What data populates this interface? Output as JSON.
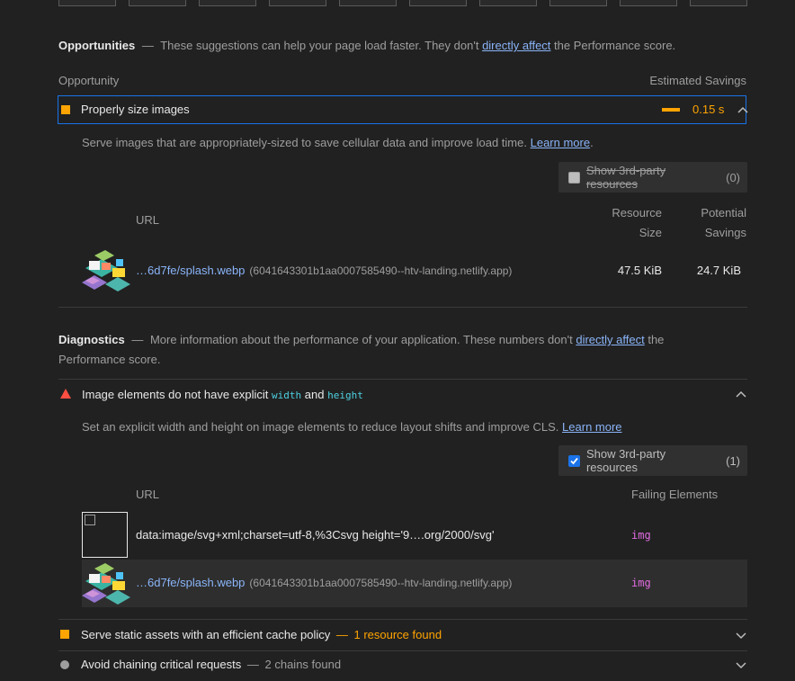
{
  "opportunities": {
    "title": "Opportunities",
    "dash": "—",
    "desc_prefix": "These suggestions can help your page load faster. They don't",
    "desc_link": "directly affect",
    "desc_suffix": "the Performance score.",
    "col_opportunity": "Opportunity",
    "col_savings": "Estimated Savings",
    "audit": {
      "title": "Properly size images",
      "savings": "0.15 s",
      "description": "Serve images that are appropriately-sized to save cellular data and improve load time.",
      "learn_more": "Learn more",
      "period": ".",
      "third_party_label": "Show 3rd-party resources",
      "third_party_count": "(0)",
      "headers": {
        "url": "URL",
        "resource_size_1": "Resource",
        "resource_size_2": "Size",
        "potential_1": "Potential",
        "potential_2": "Savings"
      },
      "rows": [
        {
          "url": "…6d7fe/splash.webp",
          "host": "(6041643301b1aa0007585490--htv-landing.netlify.app)",
          "size": "47.5 KiB",
          "savings": "24.7 KiB"
        }
      ]
    }
  },
  "diagnostics": {
    "title": "Diagnostics",
    "dash": "—",
    "desc_prefix": "More information about the performance of your application. These numbers don't",
    "desc_link": "directly affect",
    "desc_suffix_1": "the",
    "desc_suffix_2": "Performance score.",
    "audit": {
      "title_prefix": "Image elements do not have explicit",
      "code_width": "width",
      "and": "and",
      "code_height": "height",
      "description": "Set an explicit width and height on image elements to reduce layout shifts and improve CLS.",
      "learn_more": "Learn more",
      "third_party_label": "Show 3rd-party resources",
      "third_party_count": "(1)",
      "headers": {
        "url": "URL",
        "failing": "Failing Elements"
      },
      "rows": [
        {
          "url": "data:image/svg+xml;charset=utf-8,%3Csvg height='9….org/2000/svg'",
          "host": "",
          "element": "img"
        },
        {
          "url": "…6d7fe/splash.webp",
          "host": "(6041643301b1aa0007585490--htv-landing.netlify.app)",
          "element": "img"
        }
      ]
    },
    "cache": {
      "title": "Serve static assets with an efficient cache policy",
      "dash": "—",
      "summary": "1 resource found"
    },
    "chains": {
      "title": "Avoid chaining critical requests",
      "dash": "—",
      "summary": "2 chains found"
    }
  },
  "colors": {
    "accent_orange": "#ffa400",
    "fail_red": "#ff4e42",
    "link_blue": "#8ab4f8"
  }
}
